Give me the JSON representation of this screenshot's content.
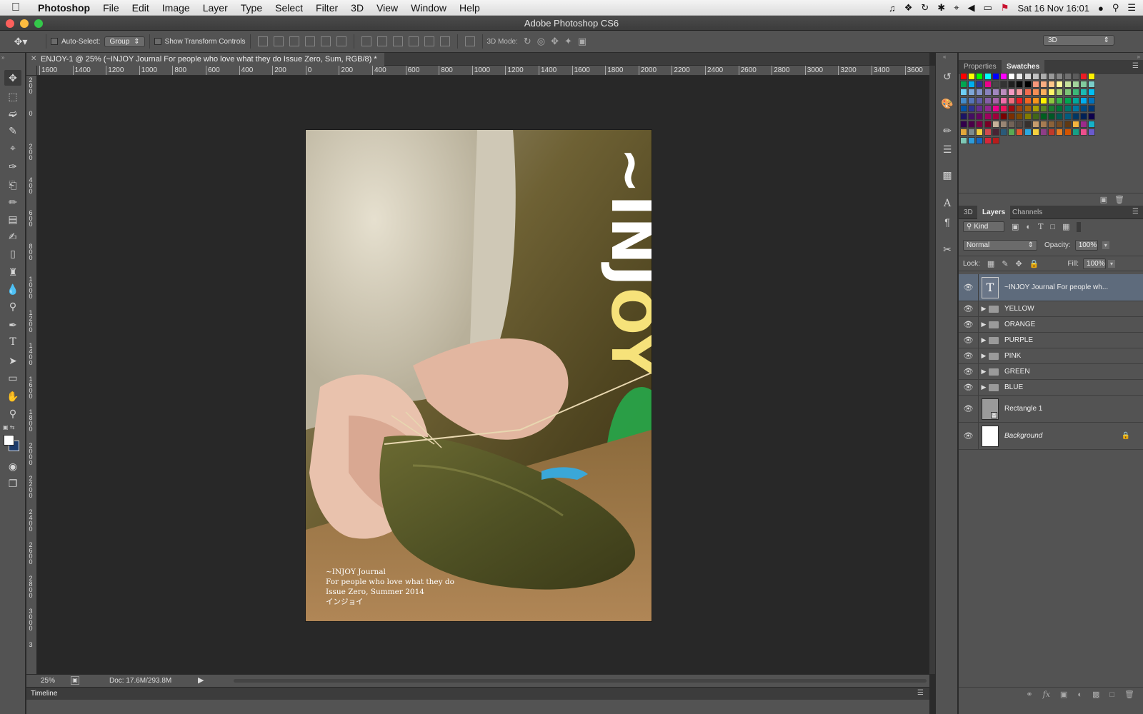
{
  "menubar": {
    "app_name": "Photoshop",
    "items": [
      "File",
      "Edit",
      "Image",
      "Layer",
      "Type",
      "Select",
      "Filter",
      "3D",
      "View",
      "Window",
      "Help"
    ],
    "datetime": "Sat 16 Nov  16:01"
  },
  "window": {
    "title": "Adobe Photoshop CS6"
  },
  "options": {
    "auto_select_label": "Auto-Select:",
    "auto_select_value": "Group",
    "show_transform_label": "Show Transform Controls",
    "mode3d_label": "3D Mode:",
    "workspace": "3D"
  },
  "document": {
    "tab_title": "ENJOY-1 @ 25% (~INJOY Journal For people who love what they do Issue Zero, Sum, RGB/8) *",
    "cover_title_white": "~INJ",
    "cover_title_yellow": "OY",
    "caption_lines": [
      "~INJOY Journal",
      "For people who love what they do",
      "Issue Zero, Summer 2014",
      "インジョイ"
    ]
  },
  "rulers": {
    "horizontal": [
      "1600",
      "1400",
      "1200",
      "1000",
      "800",
      "600",
      "400",
      "200",
      "0",
      "200",
      "400",
      "600",
      "800",
      "1000",
      "1200",
      "1400",
      "1600",
      "1800",
      "2000",
      "2200",
      "2400",
      "2600",
      "2800",
      "3000",
      "3200",
      "3400",
      "3600"
    ],
    "vertical": [
      "2\n0\n0",
      "0",
      "2\n0\n0",
      "4\n0\n0",
      "6\n0\n0",
      "8\n0\n0",
      "1\n0\n0\n0",
      "1\n2\n0\n0",
      "1\n4\n0\n0",
      "1\n6\n0\n0",
      "1\n8\n0\n0",
      "2\n0\n0\n0",
      "2\n2\n0\n0",
      "2\n4\n0\n0",
      "2\n6\n0\n0",
      "2\n8\n0\n0",
      "3\n0\n0\n0",
      "3"
    ]
  },
  "statusbar": {
    "zoom": "25%",
    "doc_info": "Doc: 17.6M/293.8M"
  },
  "timeline": {
    "label": "Timeline"
  },
  "swatches_panel": {
    "tabs": [
      "Properties",
      "Swatches"
    ],
    "active": "Swatches"
  },
  "layers_panel": {
    "tabs": [
      "3D",
      "Layers",
      "Channels"
    ],
    "active": "Layers",
    "filter_kind": "Kind",
    "blend_mode": "Normal",
    "opacity_label": "Opacity:",
    "opacity": "100%",
    "lock_label": "Lock:",
    "fill_label": "Fill:",
    "fill": "100%",
    "layers": [
      {
        "name": "~INJOY Journal For people wh...",
        "type": "text",
        "selected": true
      },
      {
        "name": "YELLOW",
        "type": "group"
      },
      {
        "name": "ORANGE",
        "type": "group"
      },
      {
        "name": "PURPLE",
        "type": "group"
      },
      {
        "name": "PINK",
        "type": "group"
      },
      {
        "name": "GREEN",
        "type": "group"
      },
      {
        "name": "BLUE",
        "type": "group"
      },
      {
        "name": "Rectangle 1",
        "type": "shape"
      },
      {
        "name": "Background",
        "type": "background",
        "locked": true
      }
    ]
  },
  "colors": {
    "accent_yellow": "#f6e27a",
    "selected_layer": "#5e6b7c",
    "foreground": "#ffffff",
    "background": "#1d3b6b"
  },
  "swatch_colors": [
    [
      "#ff0000",
      "#ffff00",
      "#00ff00",
      "#00ffff",
      "#0000ff",
      "#ff00ff",
      "#ffffff",
      "#ebebeb",
      "#d6d6d6",
      "#c2c2c2",
      "#adadad",
      "#999999",
      "#858585",
      "#707070",
      "#5c5c5c",
      "#ec1c24",
      "#fff200"
    ],
    [
      "#00a651",
      "#00aeef",
      "#2e3192",
      "#ec008c",
      "#474747",
      "#333333",
      "#1f1f1f",
      "#0a0a0a",
      "#000000",
      "#f7977a",
      "#f9ad81",
      "#fdc68a",
      "#fff79a",
      "#c4df9b",
      "#a3d39c",
      "#82ca9d",
      "#7bcdc8"
    ],
    [
      "#6ecff6",
      "#7ea7d8",
      "#8493ca",
      "#8882be",
      "#a187be",
      "#bc8dbf",
      "#f49ac2",
      "#f6989d",
      "#f26c4f",
      "#f68e55",
      "#fbaf5d",
      "#fff568",
      "#acd372",
      "#7cc576",
      "#3bb878",
      "#1abbb4",
      "#00bff3"
    ],
    [
      "#438cca",
      "#5574b9",
      "#605ca8",
      "#855fa8",
      "#a763a8",
      "#f06eaa",
      "#f26d7d",
      "#ed1c24",
      "#f26522",
      "#f7941d",
      "#fff200",
      "#8dc73f",
      "#39b54a",
      "#00a651",
      "#00a99d",
      "#00aeef",
      "#0072bc"
    ],
    [
      "#0054a6",
      "#2e3192",
      "#662d91",
      "#92278f",
      "#ec008c",
      "#ed145b",
      "#9e0b0f",
      "#a0410d",
      "#a36209",
      "#aba000",
      "#598527",
      "#197b30",
      "#007236",
      "#00746b",
      "#0076a3",
      "#004a80",
      "#003471"
    ],
    [
      "#1b1464",
      "#440e62",
      "#630460",
      "#9e005d",
      "#9e0039",
      "#790000",
      "#7b2e00",
      "#7d4900",
      "#827b00",
      "#406618",
      "#005e20",
      "#005826",
      "#005952",
      "#005b7f",
      "#003663",
      "#002157",
      "#0d004c"
    ],
    [
      "#32004b",
      "#4b0049",
      "#7b0046",
      "#7a0026",
      "#c7b299",
      "#998675",
      "#736357",
      "#534741",
      "#37302d",
      "#c69c6d",
      "#a67c52",
      "#8c6239",
      "#754c24",
      "#603913",
      "#f3b33f",
      "#9b2b8b",
      "#15b2c8"
    ],
    [
      "#e3a83b",
      "#7f8c8d",
      "#f2cf3c",
      "#d04a4f",
      "#4a2334",
      "#2a5a79",
      "#5aaa54",
      "#e4572e",
      "#2ba7df",
      "#f4d03f",
      "#8e3e88",
      "#c0392b",
      "#e67e22",
      "#d35400",
      "#16a085",
      "#ee4f8d",
      "#6a5acd"
    ],
    [
      "#7ec8b5",
      "#2d9cdb",
      "#1565c0",
      "#d62839",
      "#b71c1c"
    ]
  ]
}
